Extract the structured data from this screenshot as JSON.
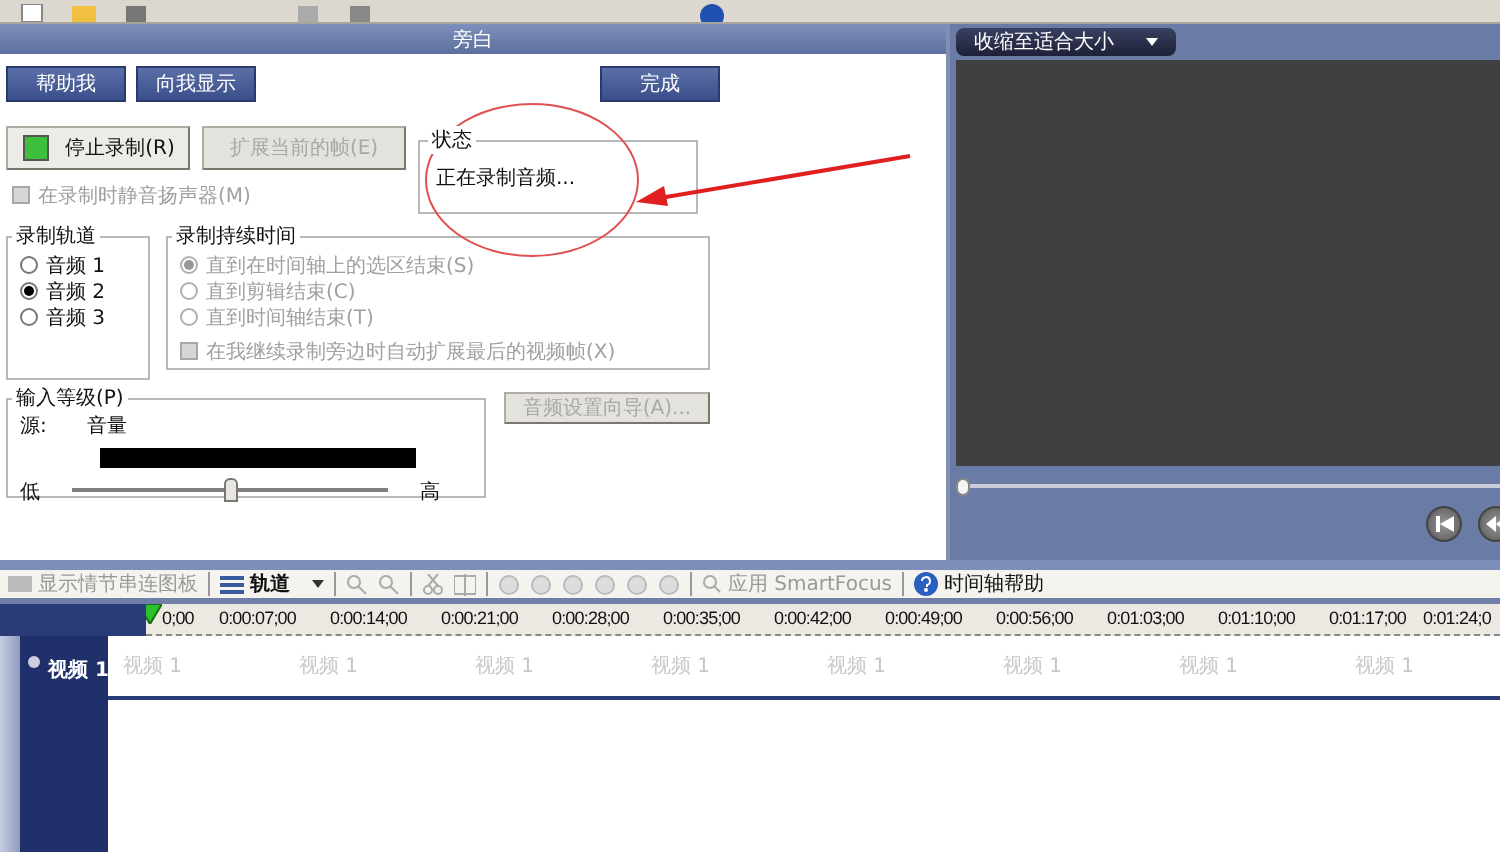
{
  "panel": {
    "title": "旁白"
  },
  "help_buttons": [
    {
      "label": "帮助我"
    },
    {
      "label": "向我显示"
    }
  ],
  "done_button": {
    "label": "完成"
  },
  "record_button": {
    "label": "停止录制(R)",
    "recording": true
  },
  "extend_button": {
    "label": "扩展当前的帧(E)",
    "disabled": true
  },
  "status": {
    "legend": "状态",
    "text": "正在录制音频..."
  },
  "mute_checkbox": {
    "label": "在录制时静音扬声器(M)",
    "checked": false,
    "disabled": true
  },
  "track_group": {
    "legend": "录制轨道",
    "options": [
      {
        "label": "音频 1",
        "selected": false
      },
      {
        "label": "音频 2",
        "selected": true
      },
      {
        "label": "音频 3",
        "selected": false
      }
    ]
  },
  "duration_group": {
    "legend": "录制持续时间",
    "disabled": true,
    "options": [
      {
        "label": "直到在时间轴上的选区结束(S)",
        "selected": true
      },
      {
        "label": "直到剪辑结束(C)",
        "selected": false
      },
      {
        "label": "直到时间轴结束(T)",
        "selected": false
      }
    ],
    "extend_checkbox": {
      "label": "在我继续录制旁边时自动扩展最后的视频帧(X)",
      "checked": false
    }
  },
  "input_level": {
    "legend": "输入等级(P)",
    "source_label": "源:",
    "source_value": "音量",
    "low": "低",
    "high": "高",
    "level": 0.5
  },
  "wizard_button": {
    "label": "音频设置向导(A)...",
    "disabled": true
  },
  "preview": {
    "zoom_dropdown": "收缩至适合大小",
    "level": 0
  },
  "timeline_toolbar": {
    "storyboard": "显示情节串连图板",
    "tracks": "轨道",
    "smartfocus": "应用 SmartFocus",
    "help": "时间轴帮助"
  },
  "ruler": [
    "0;00",
    "0:00:07;00",
    "0:00:14;00",
    "0:00:21;00",
    "0:00:28;00",
    "0:00:35;00",
    "0:00:42;00",
    "0:00:49;00",
    "0:00:56;00",
    "0:01:03;00",
    "0:01:10;00",
    "0:01:17;00",
    "0:01:24;0"
  ],
  "tracks": [
    {
      "name": "视频 1",
      "clips": [
        "视频 1",
        "视频 1",
        "视频 1",
        "视频 1",
        "视频 1",
        "视频 1",
        "视频 1",
        "视频 1"
      ]
    }
  ]
}
